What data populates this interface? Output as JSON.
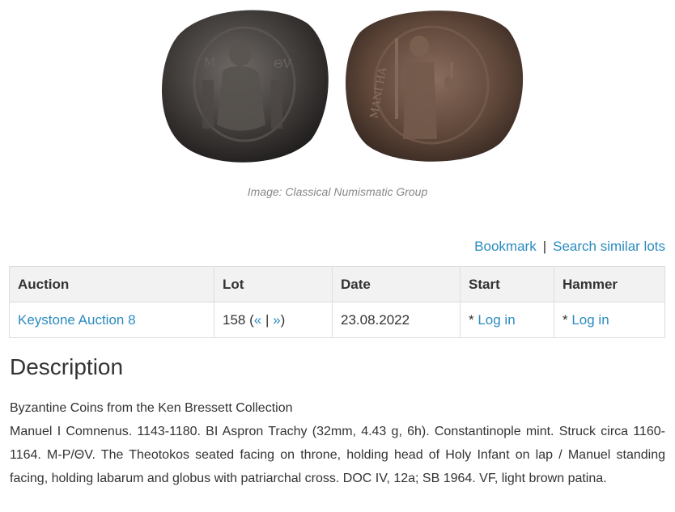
{
  "image": {
    "caption": "Image: Classical Numismatic Group",
    "obverse_icon": "coin-obverse-icon",
    "reverse_icon": "coin-reverse-icon"
  },
  "actions": {
    "bookmark": "Bookmark",
    "separator": "|",
    "search_similar": "Search similar lots"
  },
  "table": {
    "headers": [
      "Auction",
      "Lot",
      "Date",
      "Start",
      "Hammer"
    ],
    "row": {
      "auction": "Keystone Auction 8",
      "lot_number": "158",
      "lot_open": "(",
      "prev": "«",
      "lot_sep": " | ",
      "next": "»",
      "lot_close": ")",
      "date": "23.08.2022",
      "start_prefix": "* ",
      "start_link": "Log in",
      "hammer_prefix": "* ",
      "hammer_link": "Log in"
    }
  },
  "description": {
    "title": "Description",
    "collection": "Byzantine Coins from the Ken Bressett Collection",
    "text": "Manuel I Comnenus. 1143-1180. BI Aspron Trachy (32mm, 4.43 g, 6h). Constantinople mint. Struck circa 1160-1164. M-P/ΘV. The Theotokos seated facing on throne, holding head of Holy Infant on lap / Manuel standing facing, holding labarum and globus with patriarchal cross. DOC IV, 12a; SB 1964. VF, light brown patina."
  },
  "colors": {
    "link": "#2a8bbf",
    "header_bg": "#f2f2f2",
    "border": "#dddddd",
    "text": "#333333",
    "caption": "#888888"
  }
}
